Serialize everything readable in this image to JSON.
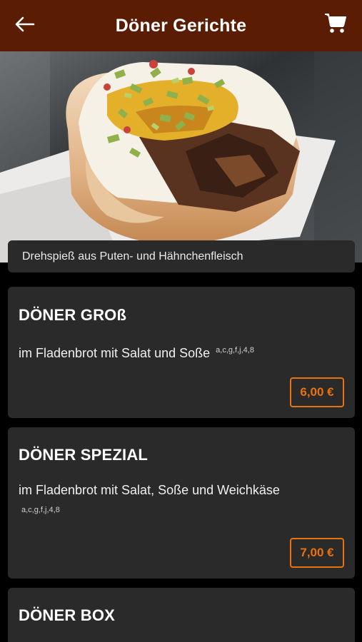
{
  "header": {
    "title": "Döner Gerichte",
    "back_icon": "arrow-left-icon",
    "cart_icon": "cart-icon",
    "background": "#5a1c02"
  },
  "category": {
    "description": "Drehspieß aus Puten- und Hähnchenfleisch"
  },
  "items": [
    {
      "name": "DÖNER GROß",
      "description": "im Fladenbrot mit Salat und Soße",
      "allergens": "a,c,g,f,j,4,8",
      "price": "6,00 €"
    },
    {
      "name": "DÖNER SPEZIAL",
      "description": "im Fladenbrot mit Salat, Soße und Weichkäse",
      "allergens": "a,c,g,f,j,4,8",
      "price": "7,00 €"
    },
    {
      "name": "DÖNER BOX"
    }
  ],
  "colors": {
    "accent": "#e8720c",
    "card": "#2a2a2a",
    "background": "#000000"
  }
}
